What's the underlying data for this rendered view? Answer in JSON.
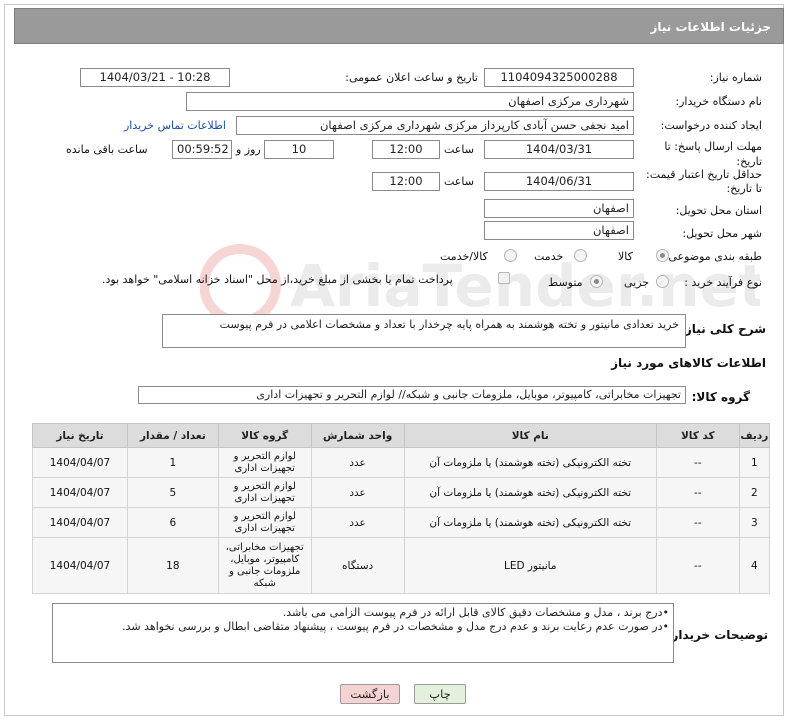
{
  "header": {
    "title": "جزئیات اطلاعات نیاز"
  },
  "form": {
    "need_number_label": "شماره نیاز:",
    "need_number": "1104094325000288",
    "announce_label": "تاریخ و ساعت اعلان عمومی:",
    "announce_value": "1404/03/21 - 10:28",
    "buyer_org_label": "نام دستگاه خریدار:",
    "buyer_org": "شهرداری مرکزی اصفهان",
    "creator_label": "ایجاد کننده درخواست:",
    "creator": "امید نجفی حسن آبادی کارپرداز مرکزی شهرداری مرکزی اصفهان",
    "contact_link": "اطلاعات تماس خریدار",
    "deadline_label_1": "مهلت ارسال پاسخ: تا",
    "deadline_label_2": "تاریخ:",
    "deadline_date": "1404/03/31",
    "time_label": "ساعت",
    "deadline_time": "12:00",
    "days_value": "10",
    "days_label": "روز و",
    "remaining_value": "00:59:52",
    "remaining_label": "ساعت باقی مانده",
    "price_label_1": "حداقل تاریخ اعتبار قیمت:",
    "price_label_2": "تا تاریخ:",
    "price_date": "1404/06/31",
    "price_time": "12:00",
    "province_label": "استان محل تحویل:",
    "province": "اصفهان",
    "city_label": "شهر محل تحویل:",
    "city": "اصفهان",
    "category_label": "طبقه بندی موضوعی:",
    "category_options": [
      "کالا",
      "خدمت",
      "کالا/خدمت"
    ],
    "process_label": "نوع فرآیند خرید :",
    "process_options": [
      "جزیی",
      "متوسط"
    ],
    "payment_note": "پرداخت تمام یا بخشی از مبلغ خرید،از محل \"اسناد خزانه اسلامی\" خواهد بود."
  },
  "description": {
    "label": "شرح کلی نیاز:",
    "text": "خرید تعدادی مانیتور و تخته هوشمند به همراه پایه چرخدار با تعداد و مشخصات اعلامی در فرم پیوست"
  },
  "items_section": {
    "title": "اطلاعات کالاهای مورد نیاز",
    "group_label": "گروه کالا:",
    "group_value": "تجهیزات مخابراتی، کامپیوتر، موبایل، ملزومات جانبی و شبکه// لوازم التحریر و تجهیزات اداری"
  },
  "table": {
    "headers": [
      "ردیف",
      "کد کالا",
      "نام کالا",
      "واحد شمارش",
      "گروه کالا",
      "تعداد / مقدار",
      "تاریخ نیاز"
    ],
    "rows": [
      {
        "row": "1",
        "code": "--",
        "name": "تخته الکترونیکی (تخته هوشمند) یا ملزومات آن",
        "unit": "عدد",
        "group": "لوازم التحریر و تجهیزات اداری",
        "qty": "1",
        "date": "1404/04/07"
      },
      {
        "row": "2",
        "code": "--",
        "name": "تخته الکترونیکی (تخته هوشمند) یا ملزومات آن",
        "unit": "عدد",
        "group": "لوازم التحریر و تجهیزات اداری",
        "qty": "5",
        "date": "1404/04/07"
      },
      {
        "row": "3",
        "code": "--",
        "name": "تخته الکترونیکی (تخته هوشمند) یا ملزومات آن",
        "unit": "عدد",
        "group": "لوازم التحریر و تجهیزات اداری",
        "qty": "6",
        "date": "1404/04/07"
      },
      {
        "row": "4",
        "code": "--",
        "name": "مانیتور LED",
        "unit": "دستگاه",
        "group": "تجهیزات مخابراتی، کامپیوتر، موبایل، ملزومات جانبی و شبکه",
        "qty": "18",
        "date": "1404/04/07"
      }
    ]
  },
  "buyer_notes": {
    "label": "توضیحات خریدار:",
    "lines": [
      "•درج برند ، مدل و مشخصات دقیق کالای قابل ارائه در فرم پیوست الزامی می باشد.",
      "•در صورت عدم رعایت برند و عدم درج مدل و مشخصات در فرم پیوست ، پیشنهاد متقاضی ابطال و بررسی نخواهد شد."
    ]
  },
  "buttons": {
    "print": "چاپ",
    "back": "بازگشت"
  },
  "watermark_text": "AriaTender.net",
  "colors": {
    "header_bg": "#9a9a9a",
    "link": "#1a4fa0",
    "back_bg": "#f6d3d3",
    "print_bg": "#e3f1dc"
  }
}
